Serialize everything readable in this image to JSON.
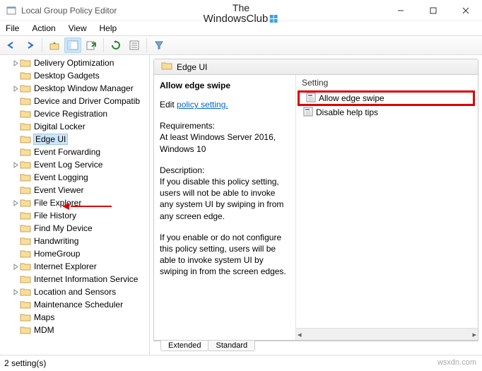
{
  "window": {
    "title": "Local Group Policy Editor",
    "brand_top": "The",
    "brand_bottom": "WindowsClub"
  },
  "menubar": [
    "File",
    "Action",
    "View",
    "Help"
  ],
  "tree": {
    "items": [
      "Delivery Optimization",
      "Desktop Gadgets",
      "Desktop Window Manager",
      "Device and Driver Compatib",
      "Device Registration",
      "Digital Locker",
      "Edge UI",
      "Event Forwarding",
      "Event Log Service",
      "Event Logging",
      "Event Viewer",
      "File Explorer",
      "File History",
      "Find My Device",
      "Handwriting",
      "HomeGroup",
      "Internet Explorer",
      "Internet Information Service",
      "Location and Sensors",
      "Maintenance Scheduler",
      "Maps",
      "MDM"
    ],
    "expandable": [
      true,
      false,
      true,
      false,
      false,
      false,
      false,
      false,
      true,
      false,
      false,
      true,
      false,
      false,
      false,
      false,
      true,
      false,
      true,
      false,
      false,
      false
    ],
    "selected_index": 6
  },
  "crumb": {
    "title": "Edge UI"
  },
  "desc": {
    "heading": "Allow edge swipe",
    "edit_prefix": "Edit ",
    "edit_link": "policy setting.",
    "req_label": "Requirements:",
    "req_text": "At least Windows Server 2016, Windows 10",
    "descr_label": "Description:",
    "descr_text1": "If you disable this policy setting, users will not be able to invoke any system UI by swiping in from any screen edge.",
    "descr_text2": "If you enable or do not configure this policy setting, users will be able to invoke system UI by swiping in from the screen edges."
  },
  "settings": {
    "column_header": "Setting",
    "rows": [
      {
        "label": "Allow edge swipe",
        "highlight": true
      },
      {
        "label": "Disable help tips",
        "highlight": false
      }
    ]
  },
  "tabs": {
    "extended": "Extended",
    "standard": "Standard"
  },
  "status": "2 setting(s)",
  "watermark": "wsxdn.com"
}
